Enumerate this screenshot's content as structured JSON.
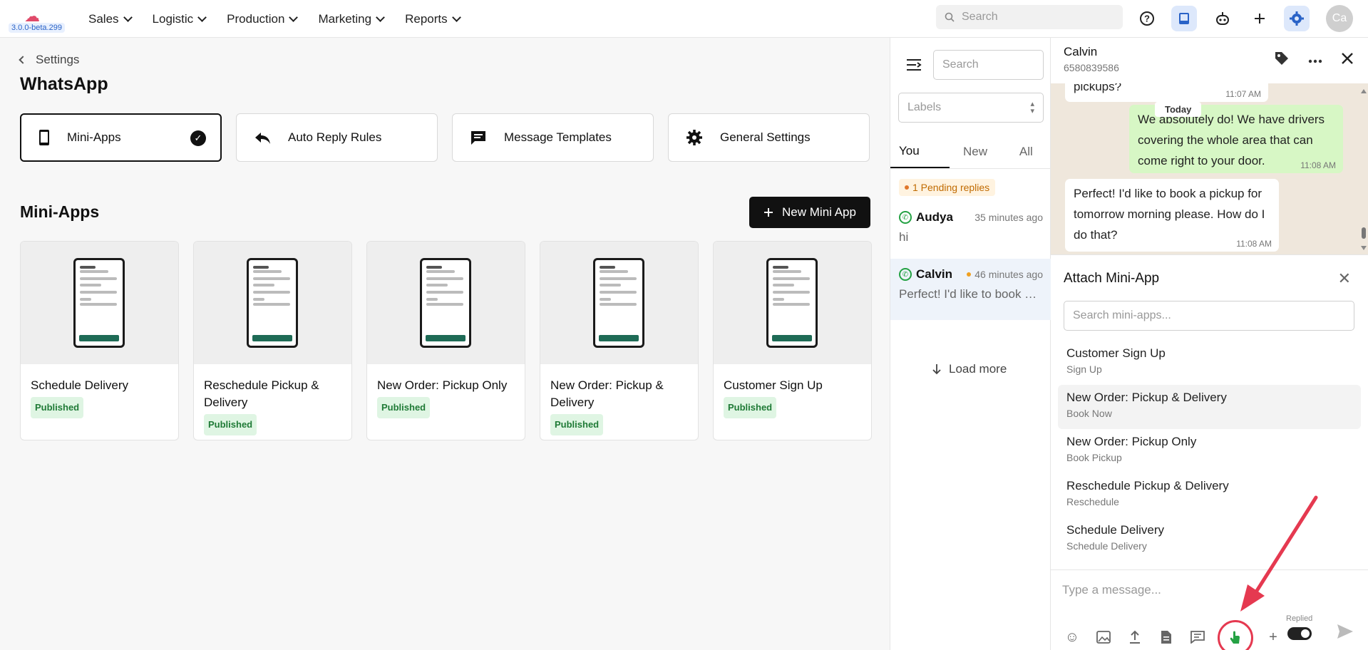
{
  "app": {
    "version": "3.0.0-beta.299"
  },
  "nav": {
    "items": [
      "Sales",
      "Logistic",
      "Production",
      "Marketing",
      "Reports"
    ],
    "search_placeholder": "Search",
    "avatar_initials": "Ca"
  },
  "settings": {
    "breadcrumb": "Settings",
    "title": "WhatsApp",
    "tabs": [
      "Mini-Apps",
      "Auto Reply Rules",
      "Message Templates",
      "General Settings"
    ],
    "section_title": "Mini-Apps",
    "new_button": "New Mini App",
    "apps": [
      {
        "name": "Schedule Delivery",
        "status": "Published"
      },
      {
        "name": "Reschedule Pickup & Delivery",
        "status": "Published"
      },
      {
        "name": "New Order: Pickup Only",
        "status": "Published"
      },
      {
        "name": "New Order: Pickup & Delivery",
        "status": "Published"
      },
      {
        "name": "Customer Sign Up",
        "status": "Published"
      }
    ]
  },
  "conversations": {
    "search_placeholder": "Search",
    "labels_placeholder": "Labels",
    "tabs": [
      "You",
      "New",
      "All"
    ],
    "pending": "1 Pending replies",
    "items": [
      {
        "name": "Audya",
        "time": "35 minutes ago",
        "preview": "hi"
      },
      {
        "name": "Calvin",
        "time": "46 minutes ago",
        "preview": "Perfect! I'd like to book a ..."
      }
    ],
    "load_more": "Load more"
  },
  "chat": {
    "name": "Calvin",
    "phone": "6580839586",
    "messages": [
      {
        "text": "pickups?",
        "time": "11:07 AM"
      },
      {
        "text": "We absolutely do! We have drivers covering the whole area that can come right to your door.",
        "time": "11:08 AM"
      },
      {
        "text": "Perfect! I'd like to book a pickup for tomorrow morning please. How do I do that?",
        "time": "11:08 AM"
      }
    ],
    "date_divider": "Today"
  },
  "attach": {
    "title": "Attach Mini-App",
    "search_placeholder": "Search mini-apps...",
    "items": [
      {
        "name": "Customer Sign Up",
        "sub": "Sign Up"
      },
      {
        "name": "New Order: Pickup & Delivery",
        "sub": "Book Now"
      },
      {
        "name": "New Order: Pickup Only",
        "sub": "Book Pickup"
      },
      {
        "name": "Reschedule Pickup & Delivery",
        "sub": "Reschedule"
      },
      {
        "name": "Schedule Delivery",
        "sub": "Schedule Delivery"
      }
    ]
  },
  "composer": {
    "placeholder": "Type a message...",
    "replied_label": "Replied"
  },
  "colors": {
    "accent_blue": "#2a63c7",
    "whatsapp_green": "#25a244",
    "annotation_red": "#e53950"
  }
}
